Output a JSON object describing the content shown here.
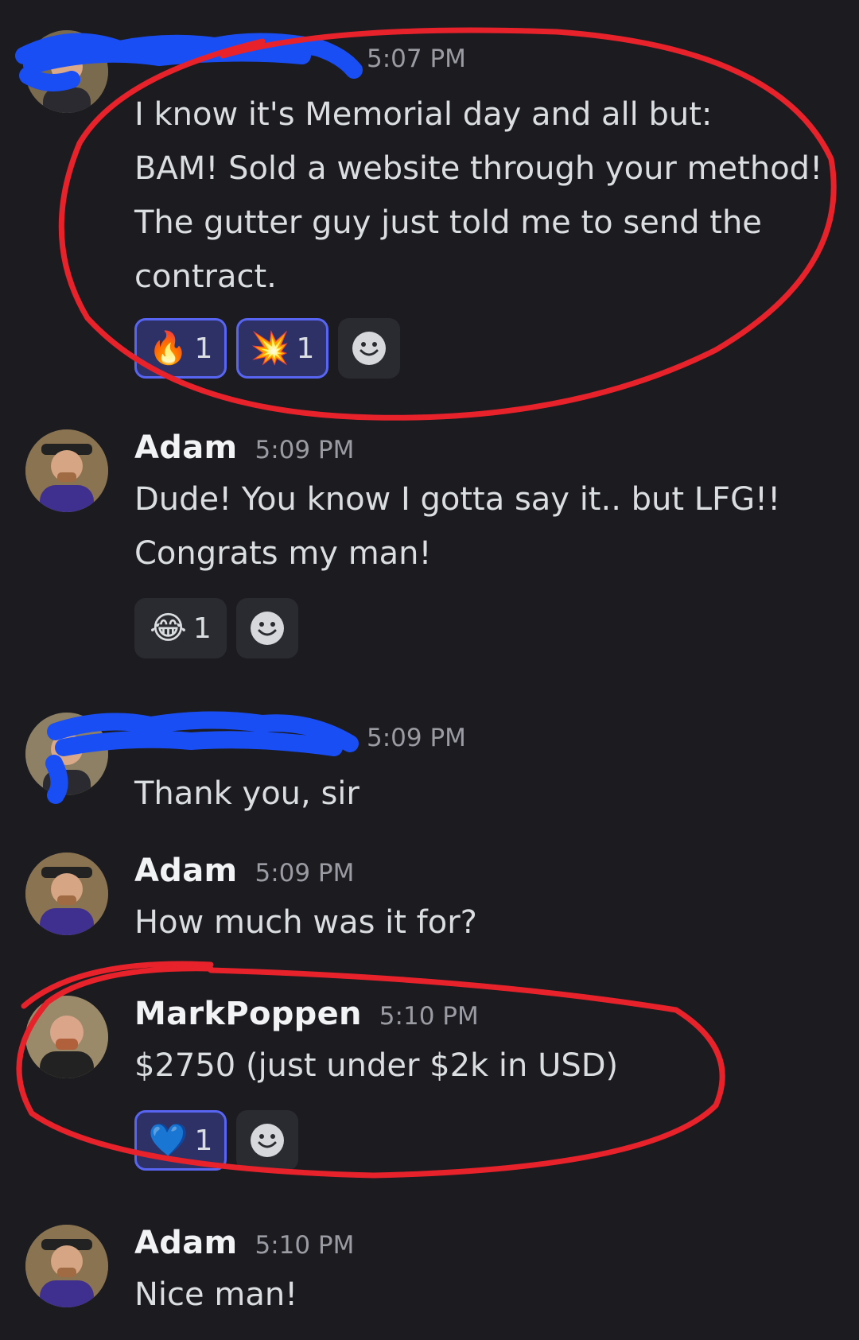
{
  "messages": [
    {
      "author": "",
      "time": "5:07 PM",
      "lines": [
        "I know it's Memorial day and all but:",
        "BAM! Sold a website through your method!",
        "The gutter guy just told me to send the",
        "contract."
      ],
      "reactions": [
        {
          "emoji": "🔥",
          "icon": "fire-icon",
          "count": "1"
        },
        {
          "emoji": "💥",
          "icon": "collision-icon",
          "count": "1"
        }
      ]
    },
    {
      "author": "Adam",
      "time": "5:09 PM",
      "lines": [
        "Dude! You know I gotta say it.. but LFG!!",
        "Congrats my man!"
      ],
      "reactions": [
        {
          "emoji": "😂",
          "icon": "tears-of-joy-icon",
          "count": "1"
        }
      ]
    },
    {
      "author": "",
      "time": "5:09 PM",
      "lines": [
        "Thank you, sir"
      ]
    },
    {
      "author": "Adam",
      "time": "5:09 PM",
      "lines": [
        "How much was it for?"
      ]
    },
    {
      "author": "MarkPoppen",
      "time": "5:10 PM",
      "lines": [
        "$2750 (just under $2k in USD)"
      ],
      "reactions": [
        {
          "emoji": "💙",
          "icon": "blue-heart-icon",
          "count": "1"
        }
      ]
    },
    {
      "author": "Adam",
      "time": "5:10 PM",
      "lines": [
        "Nice man!"
      ]
    }
  ],
  "colors": {
    "background": "#1b1b20",
    "reaction_selected_border": "#5865f2",
    "annotation_red": "#e8222a",
    "redaction_blue": "#1a4ef5"
  }
}
